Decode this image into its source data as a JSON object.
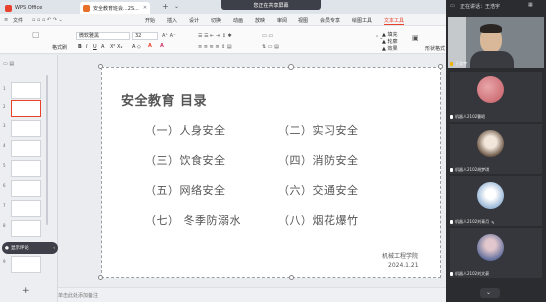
{
  "titlebar": {
    "app_tab": "WPS Office",
    "doc_tab": "安全教育班会...2S...",
    "share_banner": "您正在共享屏幕"
  },
  "menubar": {
    "file": "文件",
    "items": [
      "开始",
      "插入",
      "设计",
      "切换",
      "动画",
      "放映",
      "审阅",
      "视图",
      "会员专享",
      "绘图工具",
      "文本工具"
    ],
    "active": "文本工具"
  },
  "ribbon": {
    "format_painter": "格式刷",
    "paste": "粘贴",
    "font_name": "微软雅黑",
    "font_size": "32",
    "fill": "填充",
    "outline": "轮廓",
    "effects": "效果",
    "shape_format": "形状格式"
  },
  "thumbnails": [
    "1",
    "2",
    "3",
    "4",
    "5",
    "6",
    "7",
    "8",
    "9"
  ],
  "slide": {
    "title": "安全教育  目录",
    "items": [
      "（一）人身安全",
      "（二）实习安全",
      "（三）饮食安全",
      "（四）消防安全",
      "（五）网络安全",
      "（六）交通安全",
      "（七）  冬季防溺水",
      "（八）烟花爆竹"
    ],
    "school": "机械工程学院",
    "date": "2024.1.21"
  },
  "status": {
    "notes_placeholder": "单击此处添加备注",
    "comment_toggle": "显示评论"
  },
  "meeting": {
    "speaking_label": "正在讲话：",
    "speaker": "王浩宇",
    "host_name": "王浩宇",
    "participants": [
      "机器人2102曹昭",
      "机器人2102胡梦琪",
      "机器人2102刘青月",
      "机器人2102刘文豪"
    ]
  },
  "colors": {
    "accent_red": "#e8412c",
    "meeting_bg": "#2b2c30",
    "slide_text": "#555555"
  }
}
